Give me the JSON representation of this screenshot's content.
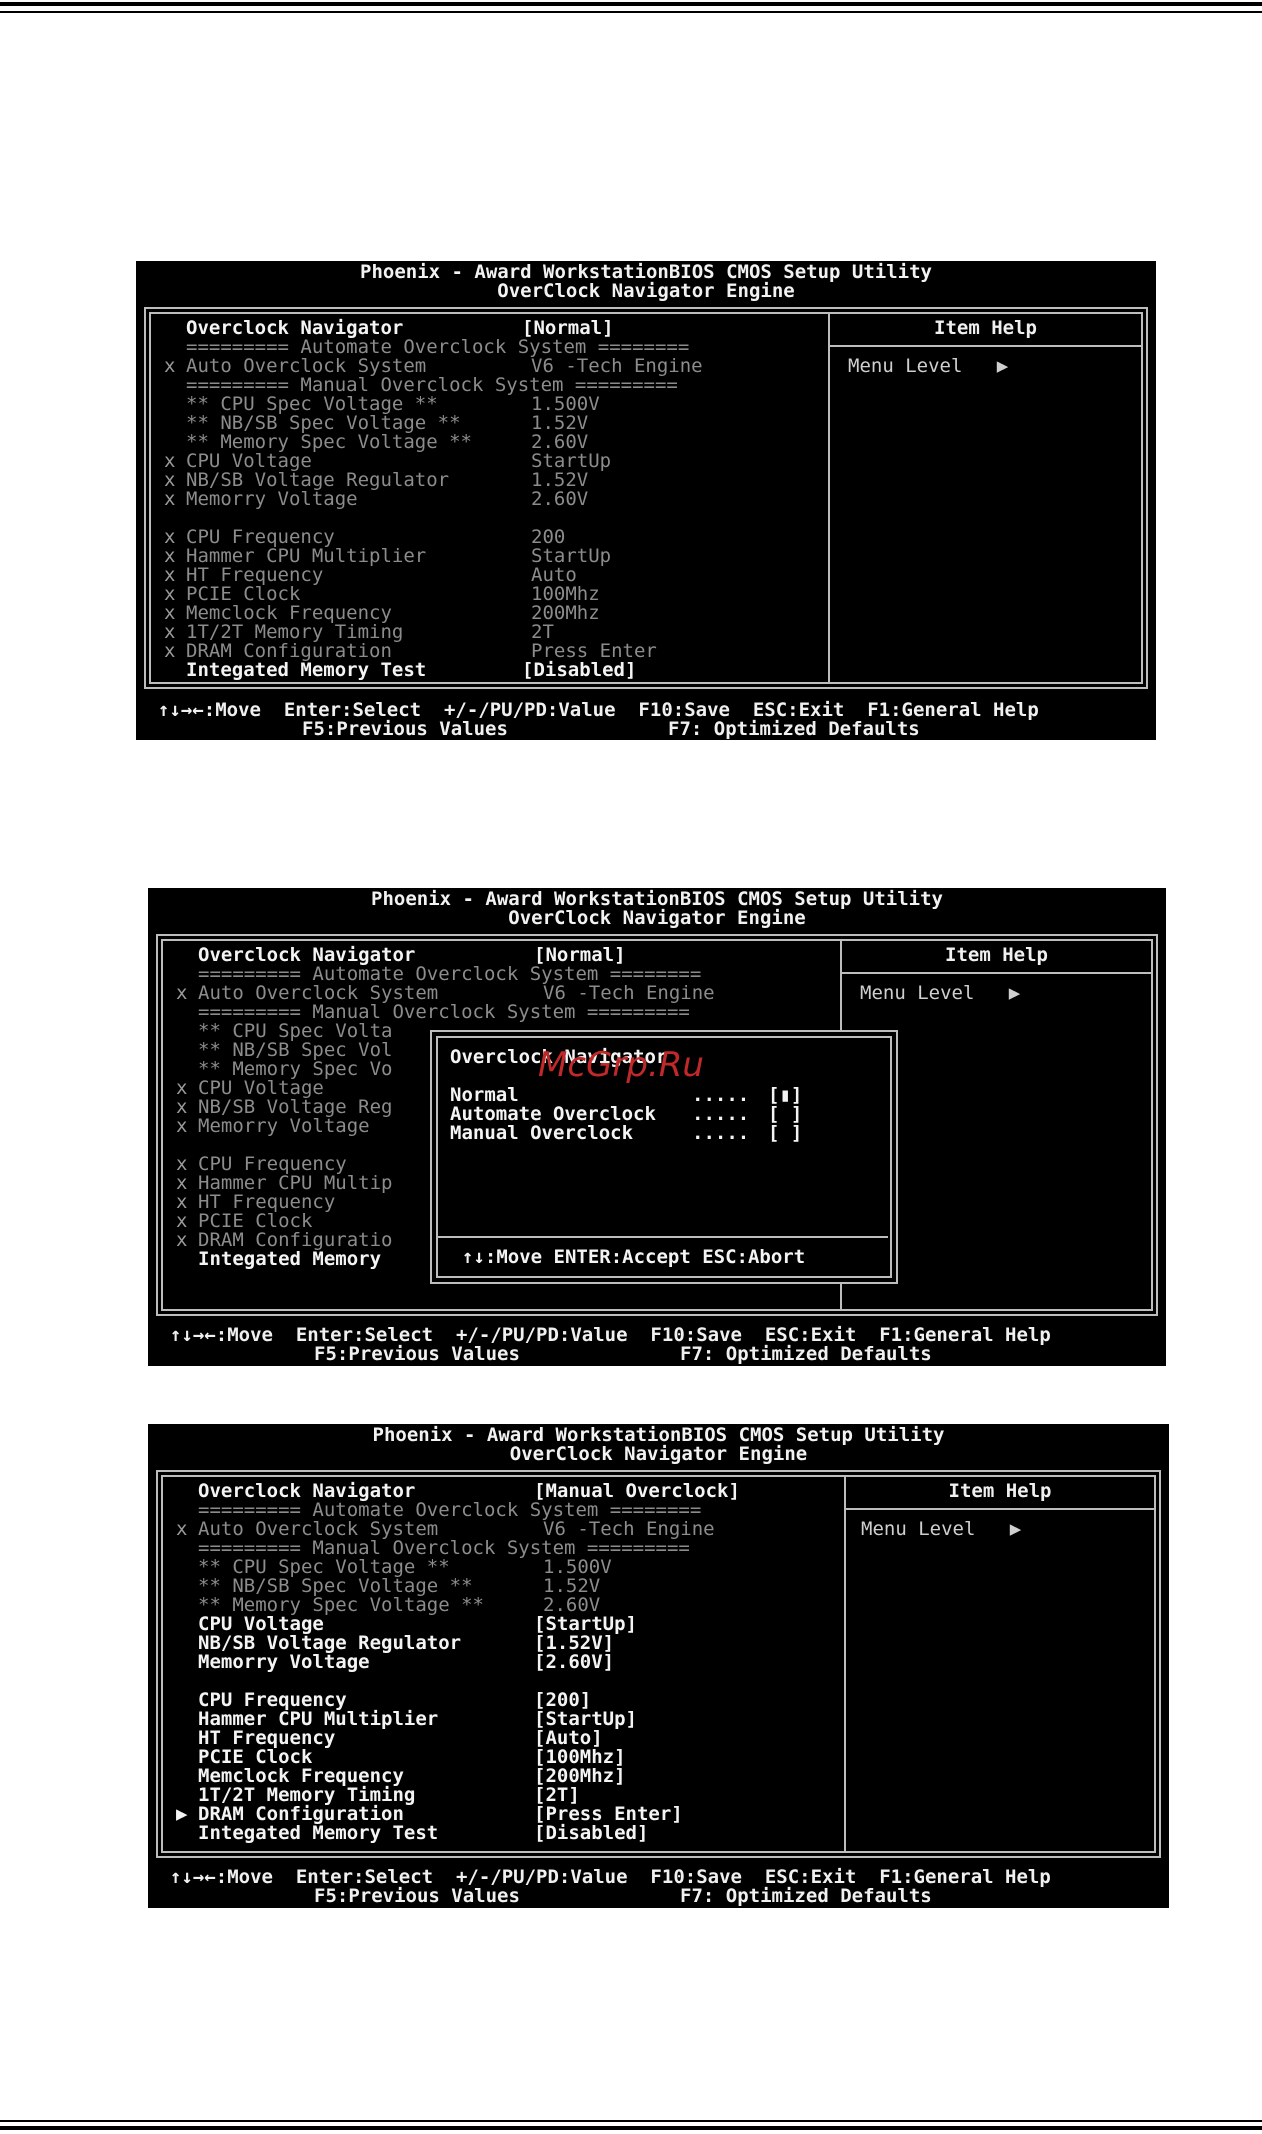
{
  "header": {
    "title": "Phoenix - Award WorkstationBIOS CMOS Setup Utility",
    "subtitle": "OverClock Navigator Engine"
  },
  "help": {
    "title": "Item Help",
    "menu_level": "Menu Level   ▶"
  },
  "footer": {
    "line1": "↑↓→←:Move  Enter:Select  +/-/PU/PD:Value  F10:Save  ESC:Exit  F1:General Help",
    "line2": "F5:Previous Values              F7: Optimized Defaults"
  },
  "shot1": {
    "rows": [
      {
        "mark": "",
        "label": "Overclock Navigator",
        "value": "[Normal]",
        "style": "bright"
      },
      {
        "mark": "",
        "label": "========= Automate Overclock System ========",
        "value": "",
        "style": "dim"
      },
      {
        "mark": "x",
        "label": "Auto Overclock System",
        "value": "V6 -Tech Engine",
        "style": "dim"
      },
      {
        "mark": "",
        "label": "========= Manual Overclock System =========",
        "value": "",
        "style": "dim"
      },
      {
        "mark": "",
        "label": "** CPU Spec Voltage **",
        "value": "1.500V",
        "style": "dim"
      },
      {
        "mark": "",
        "label": "** NB/SB Spec Voltage **",
        "value": "1.52V",
        "style": "dim"
      },
      {
        "mark": "",
        "label": "** Memory Spec Voltage **",
        "value": "2.60V",
        "style": "dim"
      },
      {
        "mark": "x",
        "label": "CPU Voltage",
        "value": "StartUp",
        "style": "dim"
      },
      {
        "mark": "x",
        "label": "NB/SB Voltage Regulator",
        "value": "1.52V",
        "style": "dim"
      },
      {
        "mark": "x",
        "label": "Memorry Voltage",
        "value": "2.60V",
        "style": "dim"
      },
      {
        "mark": "",
        "label": "",
        "value": "",
        "style": "dim"
      },
      {
        "mark": "x",
        "label": "CPU Frequency",
        "value": "200",
        "style": "dim"
      },
      {
        "mark": "x",
        "label": "Hammer CPU Multiplier",
        "value": "StartUp",
        "style": "dim"
      },
      {
        "mark": "x",
        "label": "HT Frequency",
        "value": "Auto",
        "style": "dim"
      },
      {
        "mark": "x",
        "label": "PCIE Clock",
        "value": "100Mhz",
        "style": "dim"
      },
      {
        "mark": "x",
        "label": "Memclock Frequency",
        "value": "200Mhz",
        "style": "dim"
      },
      {
        "mark": "x",
        "label": "1T/2T Memory Timing",
        "value": "2T",
        "style": "dim"
      },
      {
        "mark": "x",
        "label": "DRAM Configuration",
        "value": "Press Enter",
        "style": "dim"
      },
      {
        "mark": "",
        "label": "Integated Memory Test",
        "value": "[Disabled]",
        "style": "bright"
      }
    ]
  },
  "shot2": {
    "rows": [
      {
        "mark": "",
        "label": "Overclock Navigator",
        "value": "[Normal]",
        "style": "bright"
      },
      {
        "mark": "",
        "label": "========= Automate Overclock System ========",
        "value": "",
        "style": "dim"
      },
      {
        "mark": "x",
        "label": "Auto Overclock System",
        "value": "V6 -Tech Engine",
        "style": "dim"
      },
      {
        "mark": "",
        "label": "========= Manual Overclock System =========",
        "value": "",
        "style": "dim"
      },
      {
        "mark": "",
        "label": "** CPU Spec Volta",
        "value": "",
        "style": "dim"
      },
      {
        "mark": "",
        "label": "** NB/SB Spec Vol",
        "value": "",
        "style": "dim"
      },
      {
        "mark": "",
        "label": "** Memory Spec Vo",
        "value": "",
        "style": "dim"
      },
      {
        "mark": "x",
        "label": "CPU Voltage",
        "value": "",
        "style": "dim"
      },
      {
        "mark": "x",
        "label": "NB/SB Voltage Reg",
        "value": "",
        "style": "dim"
      },
      {
        "mark": "x",
        "label": "Memorry Voltage",
        "value": "",
        "style": "dim"
      },
      {
        "mark": "",
        "label": "",
        "value": "",
        "style": "dim"
      },
      {
        "mark": "x",
        "label": "CPU Frequency",
        "value": "",
        "style": "dim"
      },
      {
        "mark": "x",
        "label": "Hammer CPU Multip",
        "value": "",
        "style": "dim"
      },
      {
        "mark": "x",
        "label": "HT Frequency",
        "value": "",
        "style": "dim"
      },
      {
        "mark": "x",
        "label": "PCIE Clock",
        "value": "",
        "style": "dim"
      },
      {
        "mark": "x",
        "label": "DRAM Configuratio",
        "value": "",
        "style": "dim"
      },
      {
        "mark": "",
        "label": "Integated Memory",
        "value": "",
        "style": "bright"
      }
    ],
    "popup": {
      "title": "Overclock Navigator",
      "options": [
        {
          "label": "Normal",
          "dots": ".....",
          "box": "[▮]"
        },
        {
          "label": "Automate Overclock",
          "dots": ".....",
          "box": "[ ]"
        },
        {
          "label": "Manual Overclock",
          "dots": ".....",
          "box": "[ ]"
        }
      ],
      "footer": "↑↓:Move ENTER:Accept ESC:Abort"
    },
    "watermark": "McGrp.Ru"
  },
  "shot3": {
    "rows": [
      {
        "mark": "",
        "label": "Overclock Navigator",
        "value": "[Manual Overclock]",
        "style": "bright"
      },
      {
        "mark": "",
        "label": "========= Automate Overclock System ========",
        "value": "",
        "style": "dim"
      },
      {
        "mark": "x",
        "label": "Auto Overclock System",
        "value": "V6 -Tech Engine",
        "style": "dim"
      },
      {
        "mark": "",
        "label": "========= Manual Overclock System =========",
        "value": "",
        "style": "dim"
      },
      {
        "mark": "",
        "label": "** CPU Spec Voltage **",
        "value": "1.500V",
        "style": "dim"
      },
      {
        "mark": "",
        "label": "** NB/SB Spec Voltage **",
        "value": "1.52V",
        "style": "dim"
      },
      {
        "mark": "",
        "label": "** Memory Spec Voltage **",
        "value": "2.60V",
        "style": "dim"
      },
      {
        "mark": "",
        "label": "CPU Voltage",
        "value": "[StartUp]",
        "style": "bright"
      },
      {
        "mark": "",
        "label": "NB/SB Voltage Regulator",
        "value": "[1.52V]",
        "style": "bright"
      },
      {
        "mark": "",
        "label": "Memorry Voltage",
        "value": "[2.60V]",
        "style": "bright"
      },
      {
        "mark": "",
        "label": "",
        "value": "",
        "style": "bright"
      },
      {
        "mark": "",
        "label": "CPU Frequency",
        "value": "[200]",
        "style": "bright"
      },
      {
        "mark": "",
        "label": "Hammer CPU Multiplier",
        "value": "[StartUp]",
        "style": "bright"
      },
      {
        "mark": "",
        "label": "HT Frequency",
        "value": "[Auto]",
        "style": "bright"
      },
      {
        "mark": "",
        "label": "PCIE Clock",
        "value": "[100Mhz]",
        "style": "bright"
      },
      {
        "mark": "",
        "label": "Memclock Frequency",
        "value": "[200Mhz]",
        "style": "bright"
      },
      {
        "mark": "",
        "label": "1T/2T Memory Timing",
        "value": "[2T]",
        "style": "bright"
      },
      {
        "mark": "▶",
        "label": "DRAM Configuration",
        "value": "[Press Enter]",
        "style": "bright"
      },
      {
        "mark": "",
        "label": "Integated Memory Test",
        "value": "[Disabled]",
        "style": "bright"
      }
    ]
  }
}
